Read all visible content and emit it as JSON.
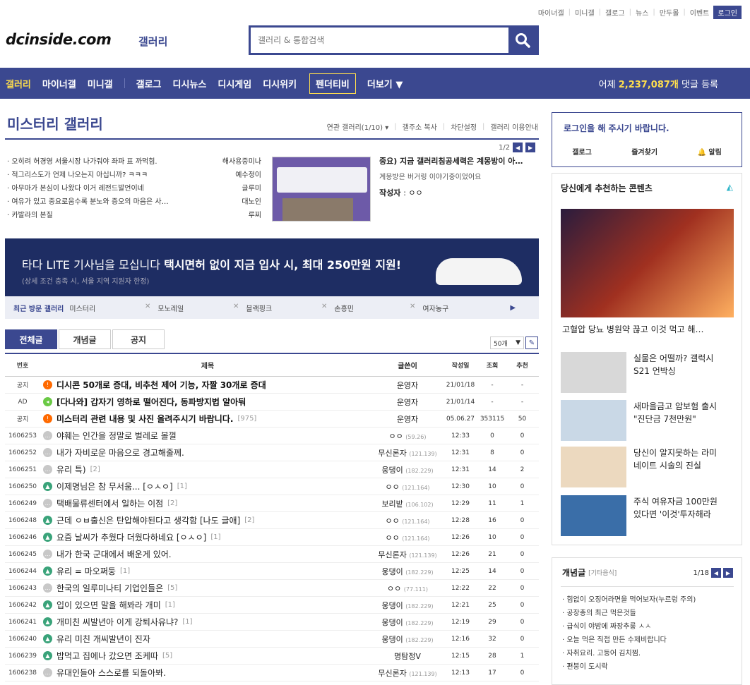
{
  "topbar": {
    "links": [
      "마이너갤",
      "미니갤",
      "갤로그",
      "뉴스",
      "만두몰",
      "이벤트"
    ],
    "login": "로그인"
  },
  "logo": {
    "main": "dcinside.com",
    "sub": "갤러리"
  },
  "search": {
    "placeholder": "갤러리 & 통합검색"
  },
  "nav": {
    "items": [
      "갤러리",
      "마이너갤",
      "미니갤"
    ],
    "items2": [
      "갤로그",
      "디시뉴스",
      "디시게임",
      "디시위키"
    ],
    "boxed": "펜더티비",
    "more": "더보기",
    "stat_prefix": "어제",
    "stat_value": "2,237,087개",
    "stat_suffix": "댓글 등록"
  },
  "gallery": {
    "title": "미스터리 갤러리",
    "menu": [
      "연관 갤러리(1/10)",
      "갤주소 복사",
      "차단설정",
      "갤러리 이용안내"
    ]
  },
  "hot": {
    "rows": [
      {
        "t": "· 오히려 허경영 서울시장 나가줘야 좌파 표 까먹힘.",
        "a": "해사용중미나"
      },
      {
        "t": "· 적그리스도가 언제 나오는지 아십니까? ㅋㅋㅋ",
        "a": "예수정이"
      },
      {
        "t": "· 아무마가 본심이 나왔다 이거 레전드발언이네",
        "a": "글루미"
      },
      {
        "t": "· 여유가 있고 중요로움수록 분노와 증오의 마음은 사…",
        "a": "대노인"
      },
      {
        "t": "· 카발라의 본질",
        "a": "루찌"
      }
    ],
    "pager": "1/2",
    "detail_title": "중요) 지금 갤러리침공세력은 계몽방이 아…",
    "detail_sub": "계몽방은 버거링 이야기중이었어요",
    "detail_author_label": "작성자",
    "detail_author": ": ㅇㅇ"
  },
  "banner": {
    "line1a": "타다 LITE 기사님을 모십니다 ",
    "line1b": "택시면허 없이 지금 입사 시, 최대 250만원 지원!",
    "line2": "(상세 조건 충족 시, 서울 지역 지원자 한정)"
  },
  "recent": {
    "label": "최근 방문 갤러리",
    "items": [
      "미스터리",
      "모노레일",
      "블랙핑크",
      "손흥민",
      "여자농구"
    ]
  },
  "tabs": [
    "전체글",
    "개념글",
    "공지"
  ],
  "listcount": "50개",
  "board": {
    "headers": [
      "번호",
      "제목",
      "글쓴이",
      "작성일",
      "조회",
      "추천"
    ],
    "rows": [
      {
        "no": "공지",
        "icon": "notice",
        "title": "디시콘 50개로 증대, 비추천 제어 기능, 자짤 30개로 증대",
        "bold": true,
        "cnt": "",
        "writer": "운영자",
        "ip": "",
        "date": "21/01/18",
        "view": "-",
        "rec": "-"
      },
      {
        "no": "AD",
        "icon": "ad",
        "title": "[다나와] 갑자기 영하로 떨어진다, 동파방지법 알아둬",
        "bold": true,
        "cnt": "",
        "writer": "운영자",
        "ip": "",
        "date": "21/01/14",
        "view": "-",
        "rec": "-"
      },
      {
        "no": "공지",
        "icon": "notice",
        "title": "미스터리 관련 내용 및 사진 올려주시기 바랍니다.",
        "bold": true,
        "cnt": "[975]",
        "writer": "운영자",
        "ip": "",
        "date": "05.06.27",
        "view": "353115",
        "rec": "50"
      },
      {
        "no": "1606253",
        "icon": "txt",
        "title": "야훼는 인간을 정말로 벌레로 볼껄",
        "bold": false,
        "cnt": "",
        "writer": "ㅇㅇ",
        "ip": "(59.26)",
        "date": "12:33",
        "view": "0",
        "rec": "0"
      },
      {
        "no": "1606252",
        "icon": "txt",
        "title": "내가 자비로운 마음으로 경고해줄께.",
        "bold": false,
        "cnt": "",
        "writer": "무신론자",
        "ip": "(121.139)",
        "date": "12:31",
        "view": "8",
        "rec": "0"
      },
      {
        "no": "1606251",
        "icon": "txt",
        "title": "유리 특)",
        "bold": false,
        "cnt": "[2]",
        "writer": "웅댕이",
        "ip": "(182.229)",
        "date": "12:31",
        "view": "14",
        "rec": "2"
      },
      {
        "no": "1606250",
        "icon": "img",
        "title": "이제명님은 참 무서움... [ㅇㅅㅇ]",
        "bold": false,
        "cnt": "[1]",
        "writer": "ㅇㅇ",
        "ip": "(121.164)",
        "date": "12:30",
        "view": "10",
        "rec": "0"
      },
      {
        "no": "1606249",
        "icon": "txt",
        "title": "택배물류센터에서 일하는 이점",
        "bold": false,
        "cnt": "[2]",
        "writer": "보리밭",
        "ip": "(106.102)",
        "date": "12:29",
        "view": "11",
        "rec": "1"
      },
      {
        "no": "1606248",
        "icon": "img",
        "title": "근데 ㅇㅂ출신은 탄압해야된다고 생각함 [나도 글애]",
        "bold": false,
        "cnt": "[2]",
        "writer": "ㅇㅇ",
        "ip": "(121.164)",
        "date": "12:28",
        "view": "16",
        "rec": "0"
      },
      {
        "no": "1606246",
        "icon": "img",
        "title": "요즘 날씨가 추웠다 더웠다하네요 [ㅇㅅㅇ]",
        "bold": false,
        "cnt": "[1]",
        "writer": "ㅇㅇ",
        "ip": "(121.164)",
        "date": "12:26",
        "view": "10",
        "rec": "0"
      },
      {
        "no": "1606245",
        "icon": "txt",
        "title": "내가 한국 군대에서 배운게 있어.",
        "bold": false,
        "cnt": "",
        "writer": "무신론자",
        "ip": "(121.139)",
        "date": "12:26",
        "view": "21",
        "rec": "0"
      },
      {
        "no": "1606244",
        "icon": "img",
        "title": "유리 = 마오쩌둥",
        "bold": false,
        "cnt": "[1]",
        "writer": "웅댕이",
        "ip": "(182.229)",
        "date": "12:25",
        "view": "14",
        "rec": "0"
      },
      {
        "no": "1606243",
        "icon": "txt",
        "title": "한국의 일루미나티 기업인들은",
        "bold": false,
        "cnt": "[5]",
        "writer": "ㅇㅇ",
        "ip": "(77.111)",
        "date": "12:22",
        "view": "22",
        "rec": "0"
      },
      {
        "no": "1606242",
        "icon": "img",
        "title": "입이 있으면 말을 해봐라 개미",
        "bold": false,
        "cnt": "[1]",
        "writer": "웅댕이",
        "ip": "(182.229)",
        "date": "12:21",
        "view": "25",
        "rec": "0"
      },
      {
        "no": "1606241",
        "icon": "img",
        "title": "개미친 씨발년아 이게 강퇴사유냐?",
        "bold": false,
        "cnt": "[1]",
        "writer": "웅댕이",
        "ip": "(182.229)",
        "date": "12:19",
        "view": "29",
        "rec": "0"
      },
      {
        "no": "1606240",
        "icon": "img",
        "title": "유리 미친 개씨발년이 진자",
        "bold": false,
        "cnt": "",
        "writer": "웅댕이",
        "ip": "(182.229)",
        "date": "12:16",
        "view": "32",
        "rec": "0"
      },
      {
        "no": "1606239",
        "icon": "img",
        "title": "밥먹고 집에나 갔으면 조케따",
        "bold": false,
        "cnt": "[5]",
        "writer": "명탐정V",
        "ip": "",
        "date": "12:15",
        "view": "28",
        "rec": "1"
      },
      {
        "no": "1606238",
        "icon": "txt",
        "title": "유대인들아 스스로를 되돌아봐.",
        "bold": false,
        "cnt": "",
        "writer": "무신론자",
        "ip": "(121.139)",
        "date": "12:13",
        "view": "17",
        "rec": "0"
      }
    ]
  },
  "sidelogin": {
    "text": "로그인을 해 주시기 바랍니다.",
    "links": [
      "갤로그",
      "즐겨찾기",
      "알림"
    ]
  },
  "recommend": {
    "title": "당신에게 추천하는 콘텐츠",
    "big_caption": "고혈압 당뇨 병원약 끊고 이것 먹고 해…",
    "items": [
      {
        "l1": "실물은 어떨까? 갤럭시",
        "l2": "S21 언박싱"
      },
      {
        "l1": "새마을금고 암보험 출시",
        "l2": "\"진단금 7천만원\""
      },
      {
        "l1": "당신이 알지못하는 라미",
        "l2": "네이트 시술의 진실"
      },
      {
        "l1": "주식 여유자금 100만원",
        "l2": "있다면 '이것'투자해라"
      }
    ]
  },
  "concept": {
    "title": "개념글",
    "cat": "[기타음식]",
    "pager": "1/18",
    "items": [
      "· 힘없이 오징어라면을 먹어보자(누르렁 주의)",
      "· 공장총의 최근 먹은것들",
      "· 급식이 야밤에 짜장추룽 ㅅㅅ",
      "· 오늘 먹은 직접 만든 수제비랍니다",
      "· 자취요리. 고등어 김치찜.",
      "· 편붕이 도시락"
    ]
  },
  "colors": {
    "primary": "#3b4890",
    "accent": "#ffde4d",
    "notice": "#ff6a00"
  }
}
